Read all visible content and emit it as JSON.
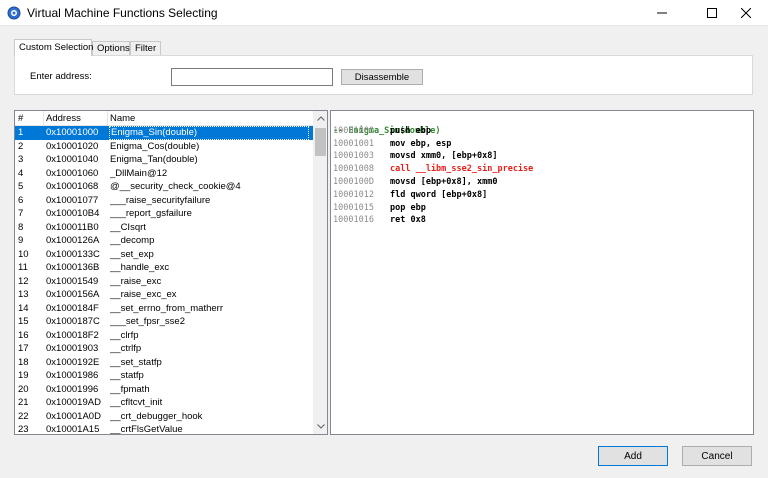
{
  "window": {
    "title": "Virtual Machine Functions Selecting"
  },
  "tabs": [
    {
      "label": "Custom Selection",
      "active": true
    },
    {
      "label": "Options",
      "active": false
    },
    {
      "label": "Filter",
      "active": false
    }
  ],
  "custom_selection": {
    "address_label": "Enter address:",
    "address_value": "",
    "disassemble_label": "Disassemble"
  },
  "function_list": {
    "columns": [
      "#",
      "Address",
      "Name"
    ],
    "selected_index": 0,
    "rows": [
      {
        "num": "1",
        "address": "0x10001000",
        "name": "Enigma_Sin(double)"
      },
      {
        "num": "2",
        "address": "0x10001020",
        "name": "Enigma_Cos(double)"
      },
      {
        "num": "3",
        "address": "0x10001040",
        "name": "Enigma_Tan(double)"
      },
      {
        "num": "4",
        "address": "0x10001060",
        "name": "_DllMain@12"
      },
      {
        "num": "5",
        "address": "0x10001068",
        "name": "@__security_check_cookie@4"
      },
      {
        "num": "6",
        "address": "0x10001077",
        "name": "___raise_securityfailure"
      },
      {
        "num": "7",
        "address": "0x100010B4",
        "name": "___report_gsfailure"
      },
      {
        "num": "8",
        "address": "0x100011B0",
        "name": "__CIsqrt"
      },
      {
        "num": "9",
        "address": "0x1000126A",
        "name": "__decomp"
      },
      {
        "num": "10",
        "address": "0x1000133C",
        "name": "__set_exp"
      },
      {
        "num": "11",
        "address": "0x1000136B",
        "name": "__handle_exc"
      },
      {
        "num": "12",
        "address": "0x10001549",
        "name": "__raise_exc"
      },
      {
        "num": "13",
        "address": "0x1000156A",
        "name": "__raise_exc_ex"
      },
      {
        "num": "14",
        "address": "0x1000184F",
        "name": "__set_errno_from_matherr"
      },
      {
        "num": "15",
        "address": "0x1000187C",
        "name": "___set_fpsr_sse2"
      },
      {
        "num": "16",
        "address": "0x100018F2",
        "name": "__clrfp"
      },
      {
        "num": "17",
        "address": "0x10001903",
        "name": "__ctrlfp"
      },
      {
        "num": "18",
        "address": "0x1000192E",
        "name": "__set_statfp"
      },
      {
        "num": "19",
        "address": "0x10001986",
        "name": "__statfp"
      },
      {
        "num": "20",
        "address": "0x10001996",
        "name": "__fpmath"
      },
      {
        "num": "21",
        "address": "0x100019AD",
        "name": "__cfltcvt_init"
      },
      {
        "num": "22",
        "address": "0x10001A0D",
        "name": "__crt_debugger_hook"
      },
      {
        "num": "23",
        "address": "0x10001A15",
        "name": "__crtFlsGetValue"
      }
    ]
  },
  "disassembly": {
    "header": "-- Enigma_Sin(double)",
    "lines": [
      {
        "address": "10001000",
        "instruction": "push ebp",
        "is_call": false
      },
      {
        "address": "10001001",
        "instruction": "mov ebp, esp",
        "is_call": false
      },
      {
        "address": "10001003",
        "instruction": "movsd xmm0, [ebp+0x8]",
        "is_call": false
      },
      {
        "address": "10001008",
        "instruction": "call __libm_sse2_sin_precise",
        "is_call": true
      },
      {
        "address": "1000100D",
        "instruction": "movsd [ebp+0x8], xmm0",
        "is_call": false
      },
      {
        "address": "10001012",
        "instruction": "fld qword [ebp+0x8]",
        "is_call": false
      },
      {
        "address": "10001015",
        "instruction": "pop ebp",
        "is_call": false
      },
      {
        "address": "10001016",
        "instruction": "ret 0x8",
        "is_call": false
      }
    ]
  },
  "buttons": {
    "add_label": "Add",
    "cancel_label": "Cancel"
  },
  "colors": {
    "selection": "#0078d7",
    "call_instruction": "#e8201a",
    "function_header": "#2e8b2e",
    "address_text": "#8c8c8c"
  },
  "icons": {
    "app": "vm-app-icon",
    "minimize": "minimize-icon",
    "maximize": "maximize-icon",
    "close": "close-icon",
    "scroll_up": "chevron-up-icon",
    "scroll_down": "chevron-down-icon"
  }
}
